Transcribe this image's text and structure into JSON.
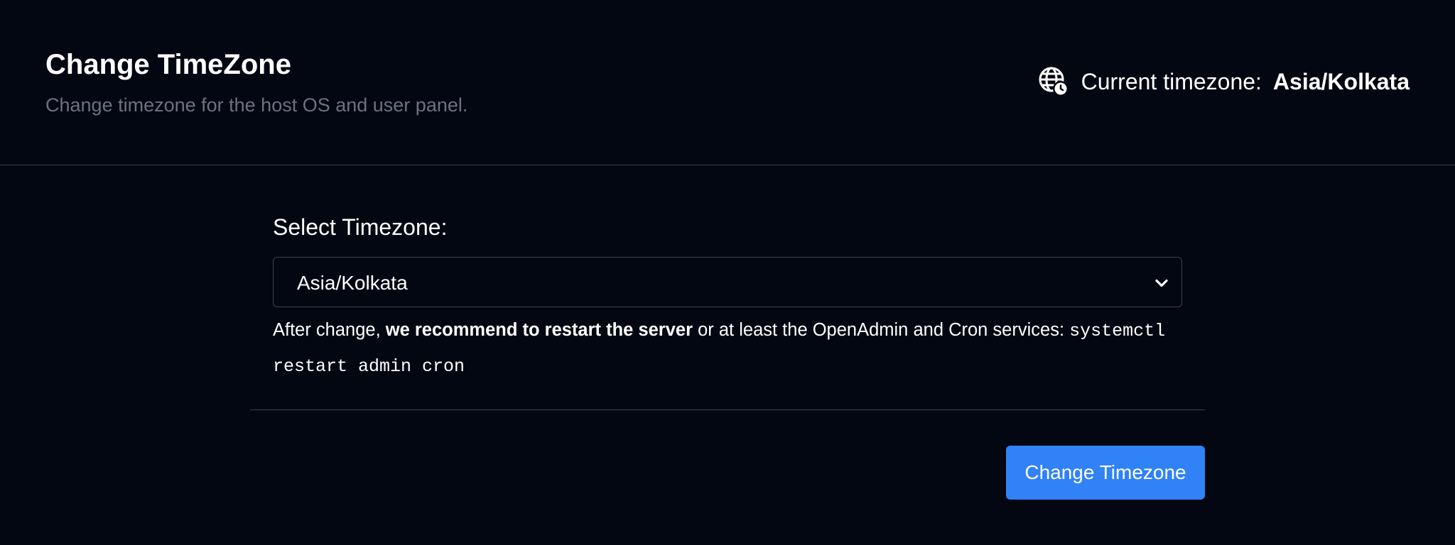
{
  "header": {
    "title": "Change TimeZone",
    "subtitle": "Change timezone for the host OS and user panel.",
    "current_label": "Current timezone:",
    "current_value": "Asia/Kolkata",
    "icon": "globe-clock-icon"
  },
  "form": {
    "select_label": "Select Timezone:",
    "selected_value": "Asia/Kolkata",
    "help": {
      "prefix": "After change, ",
      "emphasis": "we recommend to restart the server",
      "middle": " or at least the OpenAdmin and Cron services: ",
      "command": "systemctl restart admin cron"
    },
    "submit_label": "Change Timezone"
  },
  "colors": {
    "background": "#030712",
    "border": "#374151",
    "muted_text": "#6b7280",
    "accent": "#3182f6"
  }
}
